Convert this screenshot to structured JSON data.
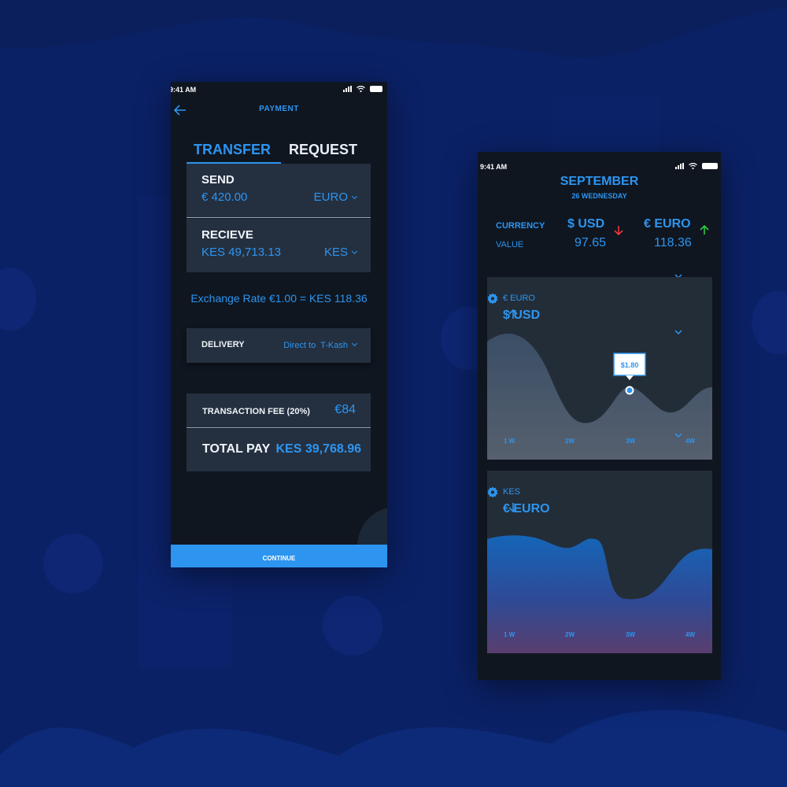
{
  "colors": {
    "accent": "#2d95f0",
    "background": "#0b2166",
    "phone_bg": "#0f1620",
    "card_bg": "#243040",
    "down": "#e83a3a",
    "up": "#2ecc40"
  },
  "payment": {
    "status_time": "9:41 AM",
    "title": "PAYMENT",
    "tabs": [
      {
        "label": "TRANSFER",
        "active": true
      },
      {
        "label": "REQUEST",
        "active": false
      }
    ],
    "send": {
      "label": "SEND",
      "amount": "€ 420.00",
      "currency": "EURO"
    },
    "receive": {
      "label": "RECIEVE",
      "amount": "KES 49,713.13",
      "currency": "KES"
    },
    "exchange_rate": "Exchange Rate €1.00 = KES 118.36",
    "delivery": {
      "label": "DELIVERY",
      "value": "Direct to  T-Kash"
    },
    "fee": {
      "label": "TRANSACTION FEE (20%)",
      "value": "€84"
    },
    "total": {
      "label": "TOTAL PAY",
      "value": "KES 39,768.96"
    },
    "continue_label": "CONTINUE"
  },
  "rates": {
    "status_time": "9:41 AM",
    "month": "SEPTEMBER",
    "day": "26 WEDNESDAY",
    "currency_label": "CURRENCY",
    "value_label": "VALUE",
    "currencies": [
      {
        "name": "$ USD",
        "value": "97.65",
        "trend": "down"
      },
      {
        "name": "€ EURO",
        "value": "118.36",
        "trend": "up"
      }
    ],
    "charts": [
      {
        "subtitle": "€ EURO",
        "title": "$ USD",
        "trend": "up",
        "tooltip": "$1.80",
        "x_labels": [
          "1 W",
          "2W",
          "3W",
          "4W"
        ]
      },
      {
        "subtitle": "KES",
        "title": "€ EURO",
        "trend": "down",
        "x_labels": [
          "1 W",
          "2W",
          "3W",
          "4W"
        ]
      }
    ]
  }
}
